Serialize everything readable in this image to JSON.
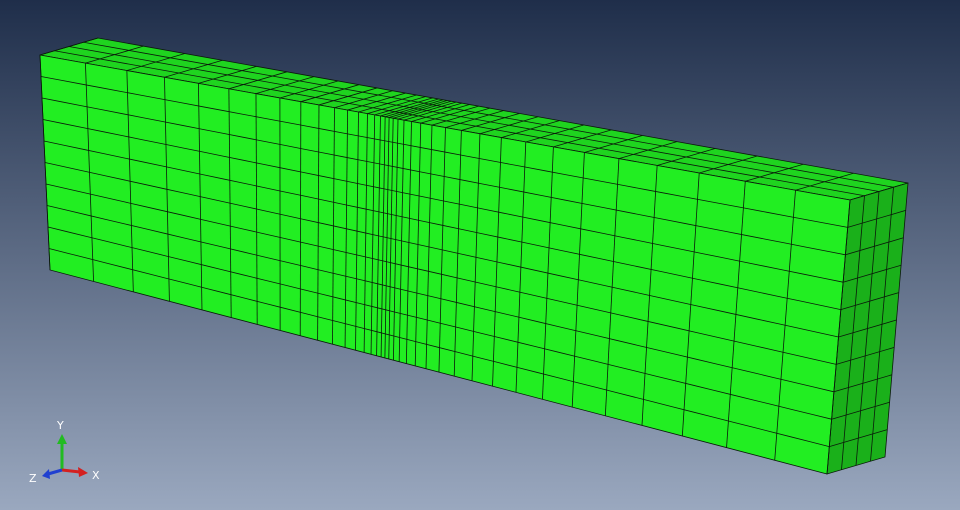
{
  "viewport": {
    "background_top": "#1f2e4a",
    "background_bottom": "#9aa8bf"
  },
  "model": {
    "face_color": "#22ee22",
    "top_color": "#1fd41f",
    "side_color": "#1ab01a",
    "edge_color": "#0a1a0a"
  },
  "triad": {
    "x_label": "X",
    "y_label": "Y",
    "z_label": "Z",
    "x_color": "#d42020",
    "y_color": "#22bb22",
    "z_color": "#2040d0"
  }
}
